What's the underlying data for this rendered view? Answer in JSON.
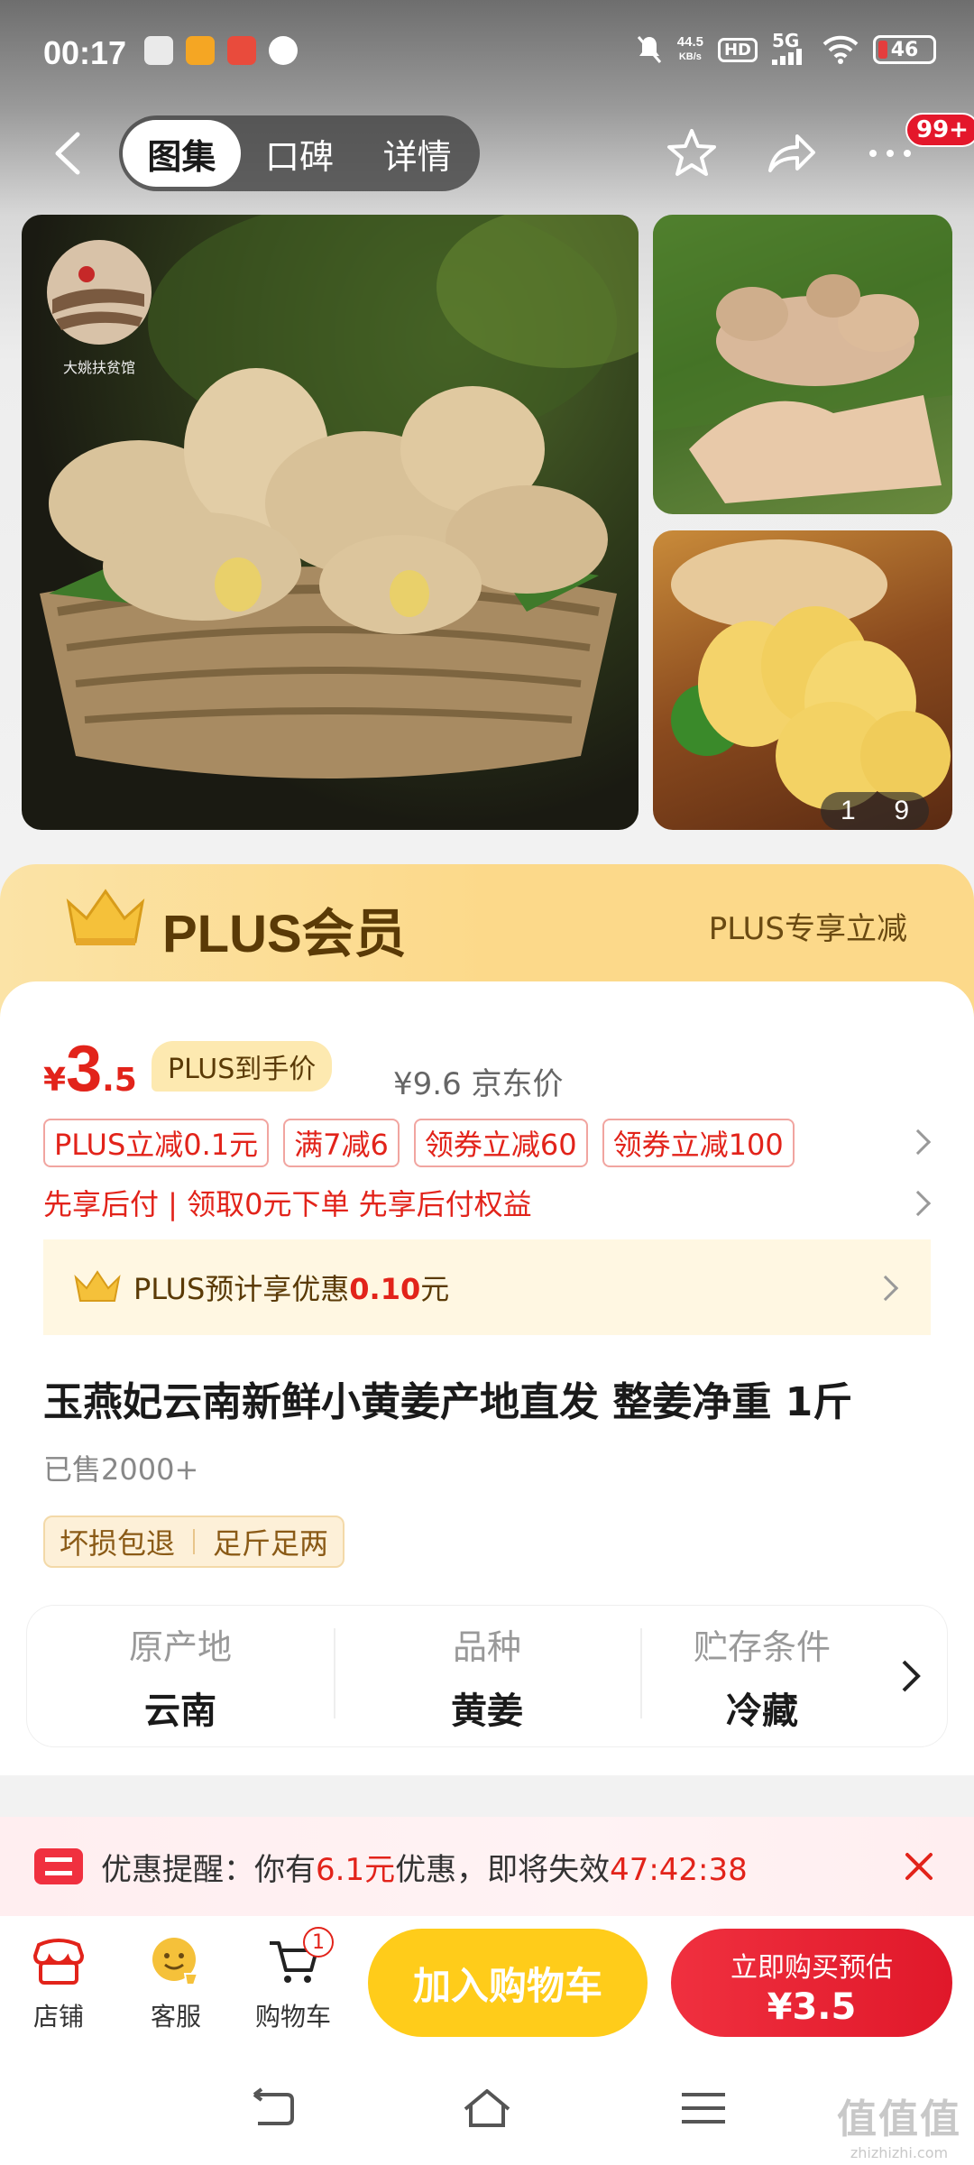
{
  "status_bar": {
    "time": "00:17",
    "net_speed_value": "44.5",
    "net_speed_unit": "KB/s",
    "hd": "HD",
    "signal": "5G",
    "battery": "46"
  },
  "nav": {
    "tabs": [
      "图集",
      "口碑",
      "详情"
    ],
    "active_tab": "图集",
    "badge": "99+"
  },
  "gallery": {
    "counter_current": "1",
    "counter_total": "9",
    "shop_logo_text": "大姚扶贫馆"
  },
  "plus_banner": {
    "title": "PLUS会员",
    "subtitle": "PLUS专享立减"
  },
  "price": {
    "symbol": "¥",
    "integer": "3",
    "decimal": ".5",
    "plus_tag": "PLUS到手价",
    "jd_price": "¥9.6 京东价"
  },
  "coupons": [
    "PLUS立减0.1元",
    "满7减6",
    "领券立减60",
    "领券立减100"
  ],
  "credit_text": "先享后付 | 领取0元下单 先享后付权益",
  "plus_save": {
    "prefix": "PLUS预计享优惠",
    "amount": "0.10",
    "suffix": "元"
  },
  "product": {
    "title": "玉燕妃云南新鲜小黄姜产地直发 整姜净重 1斤",
    "sold": "已售2000+",
    "service_tags": [
      "坏损包退",
      "足斤足两"
    ]
  },
  "attributes": [
    {
      "key": "原产地",
      "value": "云南"
    },
    {
      "key": "品种",
      "value": "黄姜"
    },
    {
      "key": "贮存条件",
      "value": "冷藏"
    }
  ],
  "reminder": {
    "prefix": "优惠提醒：你有",
    "amount": "6.1元",
    "middle": "优惠，即将失效",
    "countdown": "47:42:38"
  },
  "actions": {
    "shop": "店铺",
    "service": "客服",
    "cart": "购物车",
    "cart_count": "1",
    "add_to_cart": "加入购物车",
    "buy_line1": "立即购买预估",
    "buy_line2": "¥3.5"
  },
  "watermark": {
    "main": "值值值",
    "sub": "zhizhizhi.com"
  },
  "colors": {
    "accent_red": "#e2231a",
    "plus_gold": "#fcd98a",
    "cart_yellow": "#ffcc1a"
  }
}
